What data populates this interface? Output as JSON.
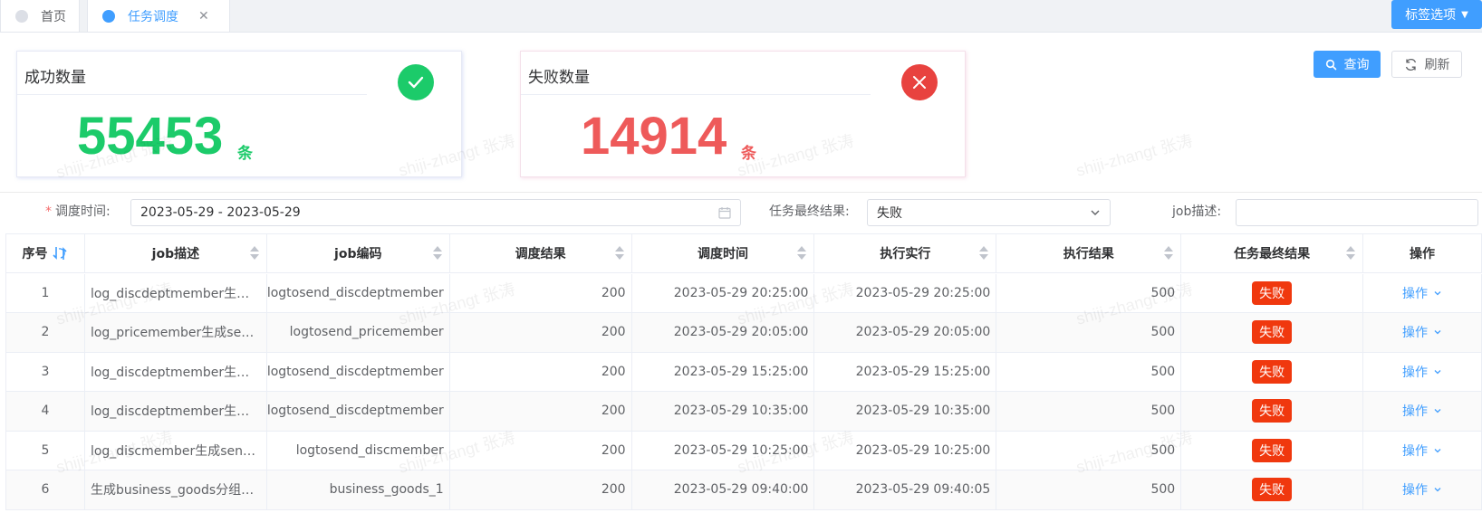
{
  "tabs": [
    {
      "label": "首页",
      "active": false
    },
    {
      "label": "任务调度",
      "active": true
    }
  ],
  "tags_button": {
    "label": "标签选项"
  },
  "stats": {
    "success": {
      "title": "成功数量",
      "value": "55453",
      "unit": "条"
    },
    "fail": {
      "title": "失败数量",
      "value": "14914",
      "unit": "条"
    }
  },
  "buttons": {
    "query": "查询",
    "refresh": "刷新"
  },
  "filters": {
    "schedule_time_label": "调度时间:",
    "schedule_time_value": "2023-05-29 - 2023-05-29",
    "final_result_label": "任务最终结果:",
    "final_result_value": "失败",
    "job_desc_label": "job描述:",
    "job_desc_value": ""
  },
  "table": {
    "headers": {
      "idx": "序号",
      "desc": "job描述",
      "code": "job编码",
      "result": "调度结果",
      "time": "调度时间",
      "exec": "执行实行",
      "exec_result": "执行结果",
      "final": "任务最终结果",
      "op": "操作"
    },
    "rows": [
      {
        "idx": "1",
        "desc": "log_discdeptmember生成s...",
        "code": "logtosend_discdeptmember",
        "result": "200",
        "time": "2023-05-29 20:25:00",
        "exec": "2023-05-29 20:25:00",
        "exec_result": "500",
        "final": "失败",
        "op": "操作"
      },
      {
        "idx": "2",
        "desc": "log_pricemember生成send...",
        "code": "logtosend_pricemember",
        "result": "200",
        "time": "2023-05-29 20:05:00",
        "exec": "2023-05-29 20:05:00",
        "exec_result": "500",
        "final": "失败",
        "op": "操作"
      },
      {
        "idx": "3",
        "desc": "log_discdeptmember生成s...",
        "code": "logtosend_discdeptmember",
        "result": "200",
        "time": "2023-05-29 15:25:00",
        "exec": "2023-05-29 15:25:00",
        "exec_result": "500",
        "final": "失败",
        "op": "操作"
      },
      {
        "idx": "4",
        "desc": "log_discdeptmember生成s...",
        "code": "logtosend_discdeptmember",
        "result": "200",
        "time": "2023-05-29 10:35:00",
        "exec": "2023-05-29 10:35:00",
        "exec_result": "500",
        "final": "失败",
        "op": "操作"
      },
      {
        "idx": "5",
        "desc": "log_discmember生成send_...",
        "code": "logtosend_discmember",
        "result": "200",
        "time": "2023-05-29 10:25:00",
        "exec": "2023-05-29 10:25:00",
        "exec_result": "500",
        "final": "失败",
        "op": "操作"
      },
      {
        "idx": "6",
        "desc": "生成business_goods分组【...",
        "code": "business_goods_1",
        "result": "200",
        "time": "2023-05-29 09:40:00",
        "exec": "2023-05-29 09:40:05",
        "exec_result": "500",
        "final": "失败",
        "op": "操作"
      }
    ]
  },
  "watermark": "shiji-zhangt 张涛",
  "colors": {
    "primary": "#409eff",
    "success": "#1ccb6a",
    "fail": "#ee5a5a",
    "fail_tag": "#f0380e"
  }
}
